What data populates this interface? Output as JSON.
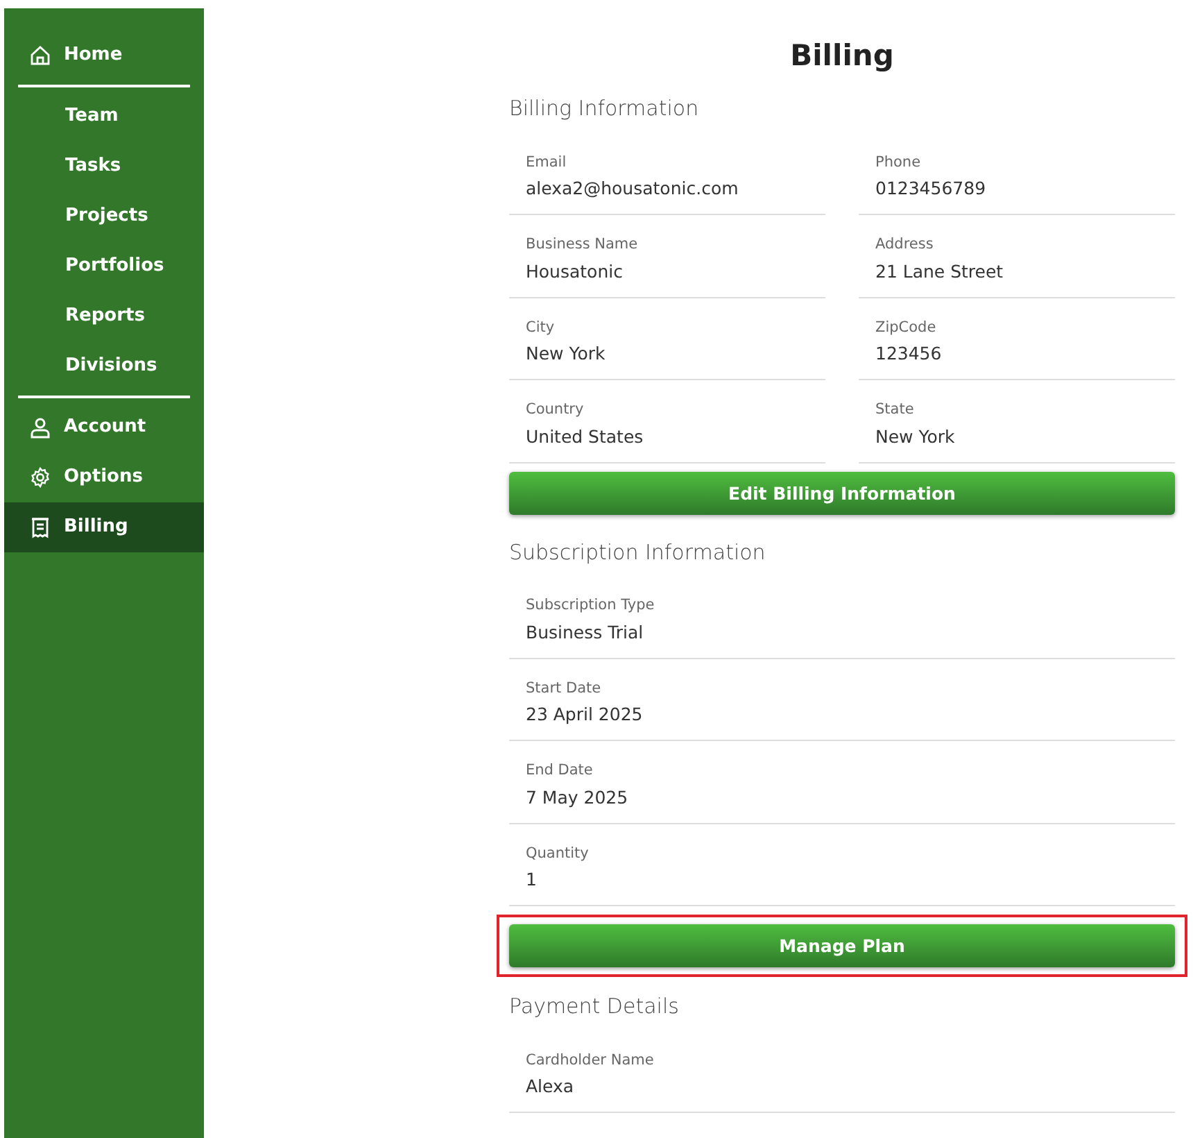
{
  "sidebar": {
    "items": [
      {
        "kind": "main",
        "label": "Home",
        "selected": false
      },
      {
        "kind": "divider"
      },
      {
        "kind": "sub",
        "label": "Team",
        "selected": false
      },
      {
        "kind": "sub",
        "label": "Tasks",
        "selected": false
      },
      {
        "kind": "sub",
        "label": "Projects",
        "selected": false
      },
      {
        "kind": "sub",
        "label": "Portfolios",
        "selected": false
      },
      {
        "kind": "sub",
        "label": "Reports",
        "selected": false
      },
      {
        "kind": "sub",
        "label": "Divisions",
        "selected": false
      },
      {
        "kind": "divider"
      },
      {
        "kind": "main",
        "label": "Account",
        "selected": false
      },
      {
        "kind": "main",
        "label": "Options",
        "selected": false
      },
      {
        "kind": "main",
        "label": "Billing",
        "selected": true
      }
    ]
  },
  "title": "Billing",
  "sections": [
    {
      "heading": "Billing Information",
      "kind": "pairs",
      "fields": [
        {
          "label": "Email",
          "value": "alexa2@housatonic.com"
        },
        {
          "label": "Phone",
          "value": "0123456789"
        },
        {
          "label": "Business Name",
          "value": "Housatonic"
        },
        {
          "label": "Address",
          "value": "21 Lane Street"
        },
        {
          "label": "City",
          "value": "New York"
        },
        {
          "label": "ZipCode",
          "value": "123456"
        },
        {
          "label": "Country",
          "value": "United States"
        },
        {
          "label": "State",
          "value": "New York"
        }
      ],
      "button": {
        "label": "Edit Billing Information",
        "highlighted": false
      }
    },
    {
      "heading": "Subscription Information",
      "kind": "list",
      "fields": [
        {
          "label": "Subscription Type",
          "value": "Business Trial"
        },
        {
          "label": "Start Date",
          "value": "23 April 2025"
        },
        {
          "label": "End Date",
          "value": "7 May 2025"
        },
        {
          "label": "Quantity",
          "value": "1"
        }
      ],
      "button": {
        "label": "Manage Plan",
        "highlighted": true
      }
    },
    {
      "heading": "Payment Details",
      "kind": "list",
      "fields": [
        {
          "label": "Cardholder Name",
          "value": "Alexa"
        }
      ]
    }
  ]
}
